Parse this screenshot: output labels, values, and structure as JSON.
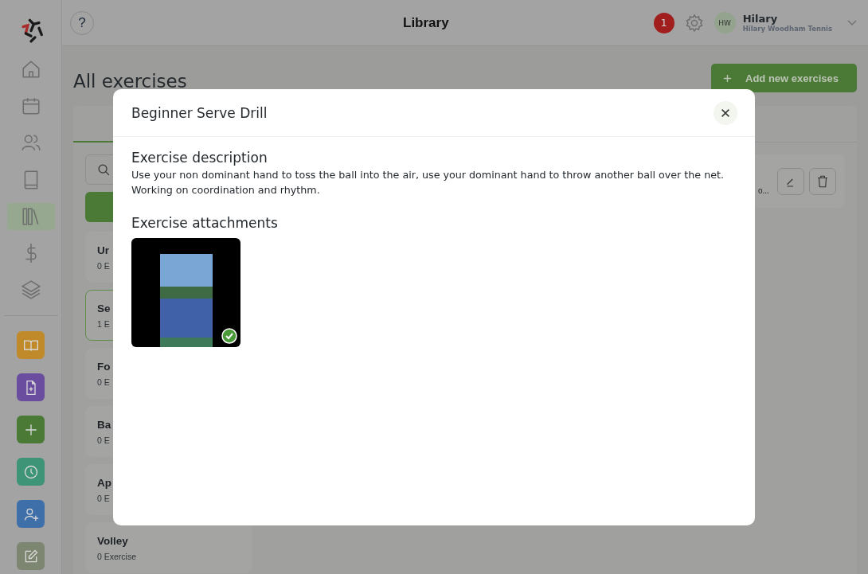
{
  "header": {
    "help": "?",
    "title": "Library",
    "notifications": "1",
    "avatar": "HW",
    "user_name": "Hilary",
    "user_org": "Hilary Woodham Tennis"
  },
  "sidebar": {
    "items": [
      {
        "kind": "home",
        "selected": false
      },
      {
        "kind": "calendar",
        "selected": false
      },
      {
        "kind": "users",
        "selected": false
      },
      {
        "kind": "book",
        "selected": false
      },
      {
        "kind": "library",
        "selected": true
      },
      {
        "kind": "dollar",
        "selected": false
      },
      {
        "kind": "layers",
        "selected": false
      }
    ],
    "shortcuts": [
      {
        "kind": "open-book",
        "color": "#c08a2a"
      },
      {
        "kind": "file-plus",
        "color": "#6a4d9e"
      },
      {
        "kind": "plus",
        "color": "#4a7a35"
      },
      {
        "kind": "clock",
        "color": "#3e9477"
      },
      {
        "kind": "user-plus",
        "color": "#3f6fa8"
      },
      {
        "kind": "edit",
        "color": "#7c8671"
      }
    ]
  },
  "page": {
    "title": "All exercises",
    "add_button": "Add new exercises"
  },
  "categories": [
    {
      "name": "Ur",
      "count": "0 E",
      "selected": false
    },
    {
      "name": "Se",
      "count": "1 E",
      "selected": true
    },
    {
      "name": "Fo",
      "count": "0 E",
      "selected": false
    },
    {
      "name": "Ba",
      "count": "0 E",
      "selected": false
    },
    {
      "name": "Ap",
      "count": "0 E",
      "selected": false
    },
    {
      "name": "Volley",
      "count": "0 Exercise",
      "selected": false
    }
  ],
  "exercise_card": {
    "snippet": "o..."
  },
  "modal": {
    "title": "Beginner Serve Drill",
    "description_heading": "Exercise description",
    "description": "Use your non dominant hand to toss the ball into the air, use your dominant hand to throw another ball over the net. Working on coordination and rhythm.",
    "attachments_heading": "Exercise attachments",
    "attachments": [
      {
        "selected": true
      }
    ]
  }
}
